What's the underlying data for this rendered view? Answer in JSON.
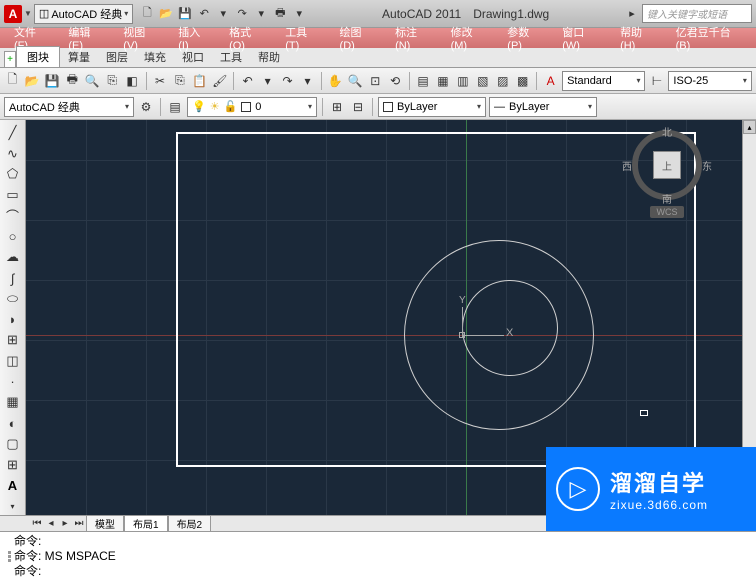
{
  "title": {
    "app": "AutoCAD 2011",
    "file": "Drawing1.dwg",
    "app_icon": "A"
  },
  "workspace": {
    "label": "AutoCAD 经典"
  },
  "search": {
    "placeholder": "键入关键字或短语"
  },
  "menu": [
    "文件(F)",
    "编辑(E)",
    "视图(V)",
    "插入(I)",
    "格式(O)",
    "工具(T)",
    "绘图(D)",
    "标注(N)",
    "修改(M)",
    "参数(P)",
    "窗口(W)",
    "帮助(H)",
    "亿君豆千台(B)"
  ],
  "tabbar": {
    "active": "图块",
    "others": [
      "算量",
      "图层",
      "填充",
      "视口",
      "工具",
      "帮助"
    ]
  },
  "toolbar2": {
    "workspace": "AutoCAD 经典",
    "layer_value": "0",
    "style": "Standard",
    "dimstyle": "ISO-25",
    "bylayer1": "ByLayer",
    "bylayer2": "ByLayer"
  },
  "viewcube": {
    "face": "上",
    "n": "北",
    "s": "南",
    "e": "东",
    "w": "西",
    "wcs": "WCS"
  },
  "ucs": {
    "x": "X",
    "y": "Y"
  },
  "bottom_tabs": {
    "model": "模型",
    "layout1": "布局1",
    "layout2": "布局2"
  },
  "cmd": {
    "l1": "命令:",
    "l2": "命令: MS MSPACE",
    "l3": "命令:"
  },
  "watermark": {
    "cn": "溜溜自学",
    "en": "zixue.3d66.com",
    "play": "▷"
  }
}
